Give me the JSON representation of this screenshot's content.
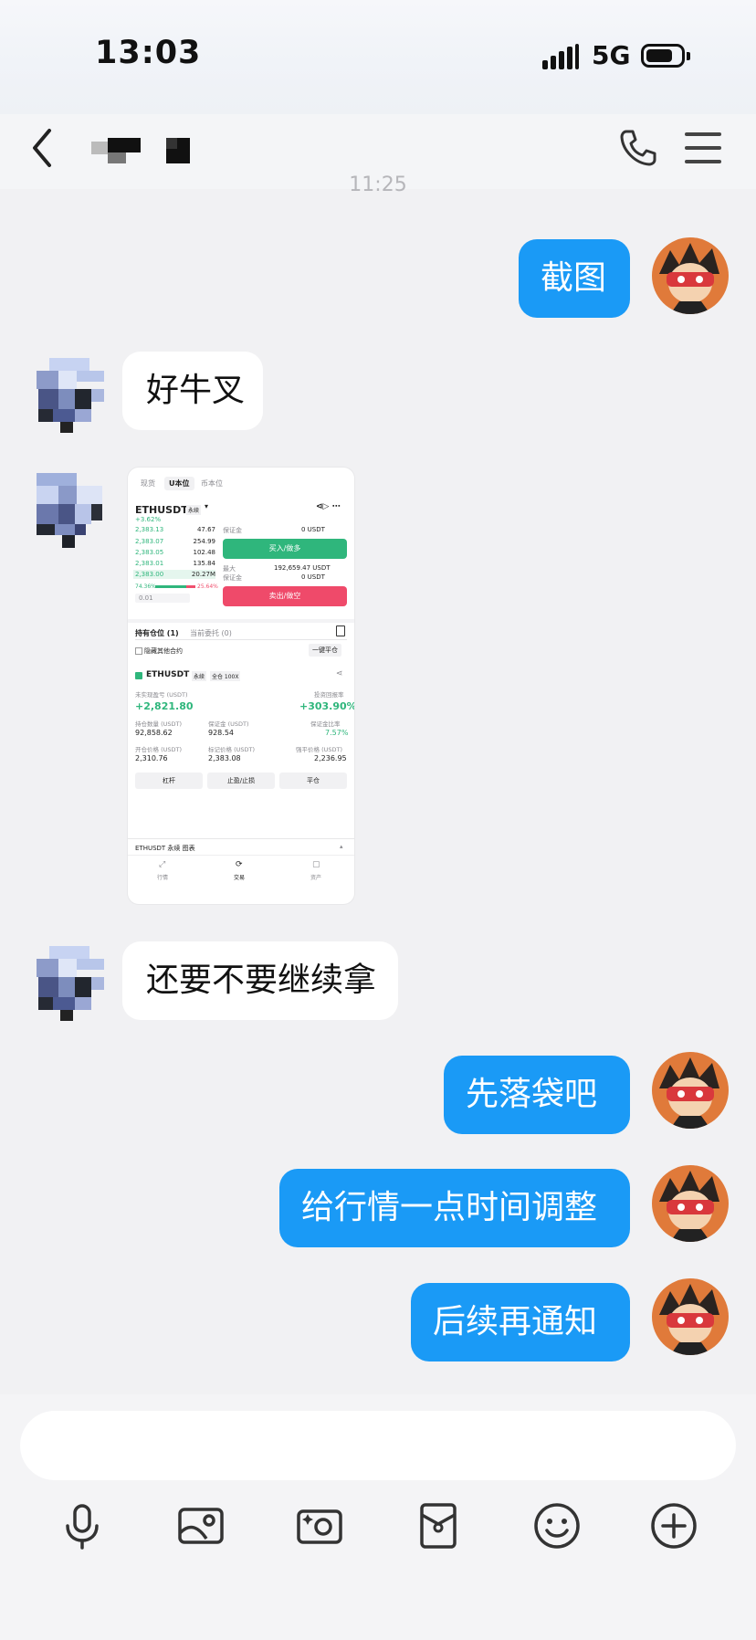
{
  "status_bar": {
    "time": "13:03",
    "network": "5G"
  },
  "header": {
    "contact_name": "",
    "back_icon": "chevron-left-icon",
    "call_icon": "phone-icon",
    "menu_icon": "hamburger-menu-icon"
  },
  "timestamp": "11:25",
  "messages": [
    {
      "from": "me",
      "text": "截图"
    },
    {
      "from": "other",
      "text": "好牛叉"
    },
    {
      "from": "other",
      "type": "image"
    },
    {
      "from": "other",
      "text": "还要不要继续拿"
    },
    {
      "from": "me",
      "text": "先落袋吧"
    },
    {
      "from": "me",
      "text": "给行情一点时间调整"
    },
    {
      "from": "me",
      "text": "后续再通知"
    }
  ],
  "shot": {
    "tabs": [
      "现货",
      "U本位",
      "币本位"
    ],
    "pair": "ETHUSDT",
    "pair_tag": "永续",
    "change": "+3.62%",
    "book": [
      {
        "price": "2,383.13",
        "qty": "47.67"
      },
      {
        "price": "2,383.07",
        "qty": "254.99"
      },
      {
        "price": "2,383.05",
        "qty": "102.48"
      },
      {
        "price": "2,383.01",
        "qty": "135.84"
      },
      {
        "price": "2,383.00",
        "qty": "20.27M"
      }
    ],
    "ratio_left": "74.36%",
    "ratio_right": "25.64%",
    "step": "0.01",
    "margin_label": "保证金",
    "margin_val": "0 USDT",
    "buy_label": "买入/做多",
    "max_label": "最大",
    "max_val": "192,659.47 USDT",
    "margin2_label": "保证金",
    "margin2_val": "0 USDT",
    "sell_label": "卖出/做空",
    "positions_tab": "持有仓位 (1)",
    "orders_tab": "当前委托 (0)",
    "hide_label": "隐藏其他合约",
    "close_all": "一键平仓",
    "pos_pair": "ETHUSDT",
    "pos_tag1": "永续",
    "pos_tag2": "全仓 100X",
    "pnl_label": "未实现盈亏 (USDT)",
    "pnl_val": "+2,821.80",
    "roe_label": "投资回报率",
    "roe_val": "+303.90%",
    "size_label": "持仓数量 (USDT)",
    "size_val": "92,858.62",
    "pmargin_label": "保证金 (USDT)",
    "pmargin_val": "928.54",
    "mratio_label": "保证金比率",
    "mratio_val": "7.57%",
    "entry_label": "开仓价格 (USDT)",
    "entry_val": "2,310.76",
    "mark_label": "标记价格 (USDT)",
    "mark_val": "2,383.08",
    "liq_label": "强平价格 (USDT)",
    "liq_val": "2,236.95",
    "btn_leverage": "杠杆",
    "btn_tpsl": "止盈/止损",
    "btn_close": "平仓",
    "chart_bar": "ETHUSDT 永续 图表",
    "nav": [
      "行情",
      "交易",
      "资产"
    ]
  },
  "composer": {
    "placeholder": "",
    "tools": [
      "microphone-icon",
      "image-icon",
      "camera-icon",
      "red-envelope-icon",
      "emoji-icon",
      "plus-circle-icon"
    ]
  }
}
